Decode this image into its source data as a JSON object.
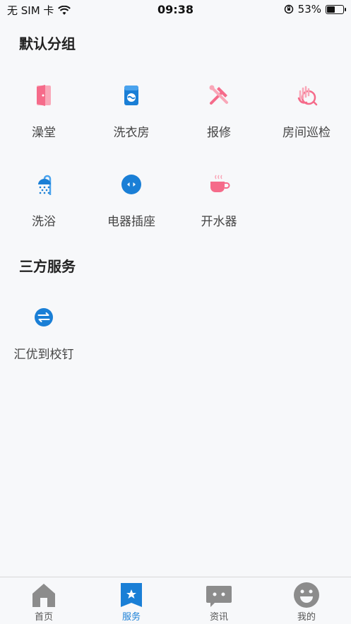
{
  "status_bar": {
    "carrier": "无 SIM 卡",
    "time": "09:38",
    "battery_percent": "53%",
    "battery_level": 0.53
  },
  "sections": [
    {
      "title": "默认分组",
      "items": [
        {
          "label": "澡堂",
          "icon": "door-icon",
          "color": "#f56b8a"
        },
        {
          "label": "洗衣房",
          "icon": "washing-machine-icon",
          "color": "#1a7fd6"
        },
        {
          "label": "报修",
          "icon": "repair-tools-icon",
          "color": "#f56b8a"
        },
        {
          "label": "房间巡检",
          "icon": "inspection-hand-icon",
          "color": "#f56b8a"
        },
        {
          "label": "洗浴",
          "icon": "shower-icon",
          "color": "#1a7fd6"
        },
        {
          "label": "电器插座",
          "icon": "socket-icon",
          "color": "#1a7fd6"
        },
        {
          "label": "开水器",
          "icon": "teacup-icon",
          "color": "#f56b8a"
        }
      ]
    },
    {
      "title": "三方服务",
      "items": [
        {
          "label": "汇优到校钉",
          "icon": "exchange-icon",
          "color": "#1a7fd6"
        }
      ]
    }
  ],
  "tab_bar": [
    {
      "label": "首页",
      "icon": "home-icon",
      "active": false
    },
    {
      "label": "服务",
      "icon": "service-bookmark-icon",
      "active": true
    },
    {
      "label": "资讯",
      "icon": "chat-bubble-icon",
      "active": false
    },
    {
      "label": "我的",
      "icon": "smiley-icon",
      "active": false
    }
  ],
  "colors": {
    "accent": "#1a7fd6",
    "pink": "#f56b8a",
    "tab_inactive": "#9b9b9b"
  }
}
